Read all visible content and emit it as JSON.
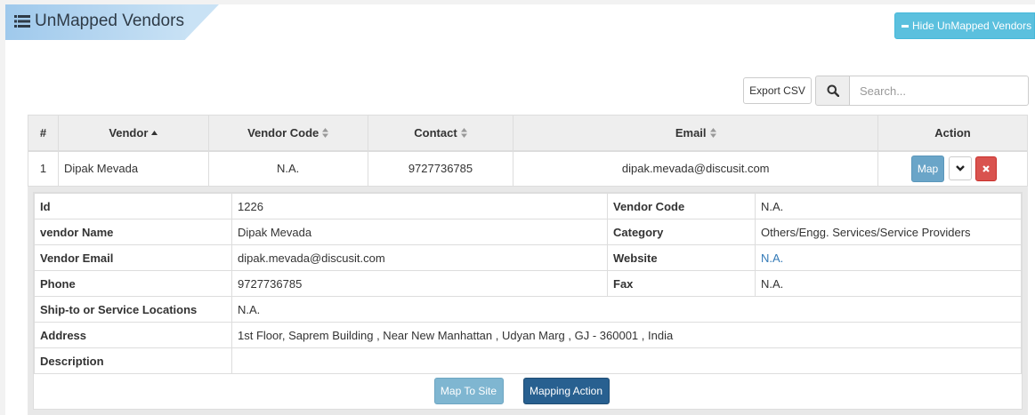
{
  "header": {
    "title": "UnMapped Vendors",
    "title_icon": "list-icon",
    "hide_button_label": "Hide UnMapped Vendors"
  },
  "toolbar": {
    "export_label": "Export CSV",
    "search_placeholder": "Search...",
    "search_value": ""
  },
  "table": {
    "columns": [
      "#",
      "Vendor",
      "Vendor Code",
      "Contact",
      "Email",
      "Action"
    ],
    "sorted_column": "Vendor",
    "sort_direction": "ascending",
    "rows": [
      {
        "num": "1",
        "vendor": "Dipak Mevada",
        "code": "N.A.",
        "contact": "9727736785",
        "email": "dipak.mevada@discusit.com",
        "map_label": "Map"
      }
    ]
  },
  "detail": {
    "id_label": "Id",
    "id_value": "1226",
    "vendor_code_label": "Vendor Code",
    "vendor_code_value": "N.A.",
    "vendor_name_label": "vendor Name",
    "vendor_name_value": "Dipak Mevada",
    "category_label": "Category",
    "category_value": "Others/Engg. Services/Service Providers",
    "vendor_email_label": "Vendor Email",
    "vendor_email_value": "dipak.mevada@discusit.com",
    "website_label": "Website",
    "website_value": "N.A.",
    "phone_label": "Phone",
    "phone_value": "9727736785",
    "fax_label": "Fax",
    "fax_value": "N.A.",
    "locations_label": "Ship-to or Service Locations",
    "locations_value": "N.A.",
    "address_label": "Address",
    "address_value": "1st Floor, Saprem Building , Near New Manhattan , Udyan Marg , GJ - 360001 , India",
    "description_label": "Description",
    "description_value": "",
    "map_to_site_label": "Map To Site",
    "mapping_action_label": "Mapping Action"
  },
  "colors": {
    "info": "#5bc0de",
    "primary": "#286090",
    "danger": "#d9534f",
    "link": "#337ab7"
  }
}
